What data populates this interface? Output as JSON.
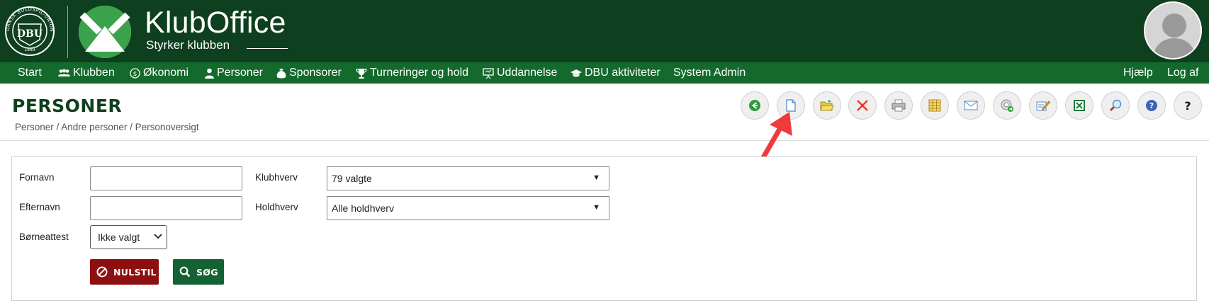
{
  "header": {
    "seal_text_ring": "DANSK BOLDSPIL-UNION",
    "seal_monogram": "DBU",
    "seal_year": "1889",
    "brand_title": "KlubOffice",
    "brand_subtitle": "Styrker klubben"
  },
  "nav": {
    "left": [
      {
        "label": "Start",
        "icon": "none"
      },
      {
        "label": "Klubben",
        "icon": "people-icon"
      },
      {
        "label": "Økonomi",
        "icon": "coin-icon"
      },
      {
        "label": "Personer",
        "icon": "person-icon"
      },
      {
        "label": "Sponsorer",
        "icon": "money-bag-icon"
      },
      {
        "label": "Turneringer og hold",
        "icon": "trophy-icon"
      },
      {
        "label": "Uddannelse",
        "icon": "presentation-icon"
      },
      {
        "label": "DBU aktiviteter",
        "icon": "graduation-cap-icon"
      },
      {
        "label": "System Admin",
        "icon": "none"
      }
    ],
    "right": [
      {
        "label": "Hjælp"
      },
      {
        "label": "Log af"
      }
    ]
  },
  "page": {
    "title": "PERSONER",
    "breadcrumb": "Personer / Andre personer / Personoversigt"
  },
  "toolbar": {
    "buttons": [
      {
        "icon": "back-arrow-icon"
      },
      {
        "icon": "new-document-icon"
      },
      {
        "icon": "open-folder-icon"
      },
      {
        "icon": "delete-x-icon"
      },
      {
        "icon": "print-icon"
      },
      {
        "icon": "table-grid-icon"
      },
      {
        "icon": "email-icon"
      },
      {
        "icon": "export-icon"
      },
      {
        "icon": "edit-icon"
      },
      {
        "icon": "excel-icon"
      },
      {
        "icon": "search-magnifier-icon"
      },
      {
        "icon": "help-blue-icon"
      },
      {
        "icon": "question-mark-icon",
        "label": "?"
      }
    ]
  },
  "form": {
    "fornavn_label": "Fornavn",
    "fornavn_value": "",
    "efternavn_label": "Efternavn",
    "efternavn_value": "",
    "boerneattest_label": "Børneattest",
    "boerneattest_value": "Ikke valgt",
    "klubhverv_label": "Klubhverv",
    "klubhverv_value": "79 valgte",
    "holdhverv_label": "Holdhverv",
    "holdhverv_value": "Alle holdhverv",
    "reset_label": "NULSTIL",
    "search_label": "SØG"
  },
  "colors": {
    "header_bg": "#0e3f1f",
    "nav_bg": "#136a2c",
    "reset_btn": "#8e0f0f",
    "search_btn": "#146232",
    "annotation_arrow": "#ef3b3b"
  }
}
